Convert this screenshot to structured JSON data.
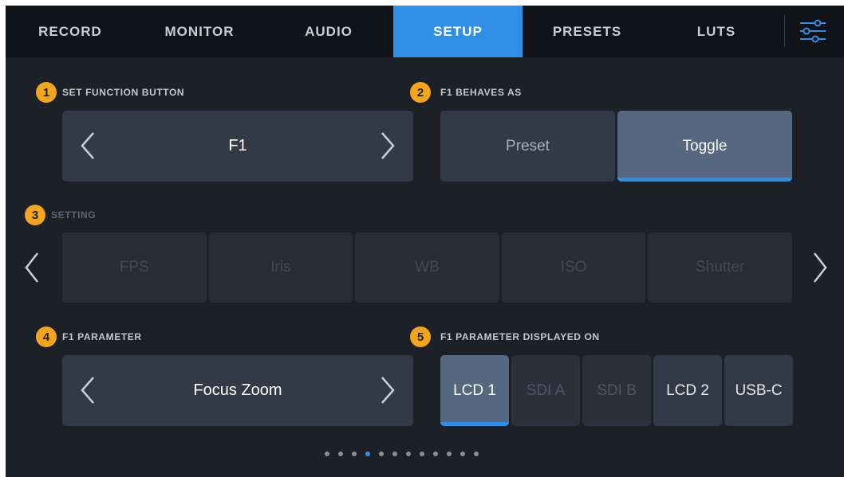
{
  "tabs": [
    {
      "label": "RECORD"
    },
    {
      "label": "MONITOR"
    },
    {
      "label": "AUDIO"
    },
    {
      "label": "SETUP"
    },
    {
      "label": "PRESETS"
    },
    {
      "label": "LUTS"
    }
  ],
  "active_tab": "SETUP",
  "icons": {
    "settings": "sliders-icon",
    "left": "chevron-left-icon",
    "right": "chevron-right-icon"
  },
  "sections": {
    "function_button": {
      "number": "1",
      "title": "SET FUNCTION BUTTON",
      "value": "F1"
    },
    "behaves_as": {
      "number": "2",
      "title": "F1 BEHAVES AS",
      "options": [
        "Preset",
        "Toggle"
      ],
      "selected": "Toggle"
    },
    "setting": {
      "number": "3",
      "title": "SETTING",
      "options": [
        "FPS",
        "Iris",
        "WB",
        "ISO",
        "Shutter"
      ]
    },
    "parameter": {
      "number": "4",
      "title": "F1 PARAMETER",
      "value": "Focus Zoom"
    },
    "displayed_on": {
      "number": "5",
      "title": "F1 PARAMETER DISPLAYED ON",
      "options": [
        "LCD 1",
        "SDI A",
        "SDI B",
        "LCD 2",
        "USB-C"
      ],
      "selected": "LCD 1",
      "disabled": [
        "SDI A",
        "SDI B"
      ]
    }
  },
  "pagination": {
    "total": 12,
    "current": 4
  },
  "colors": {
    "accent": "#2f8fe6",
    "badge": "#f4a51c",
    "panel": "#323a45",
    "selected_segment": "#56687f",
    "background": "#1c2127"
  }
}
